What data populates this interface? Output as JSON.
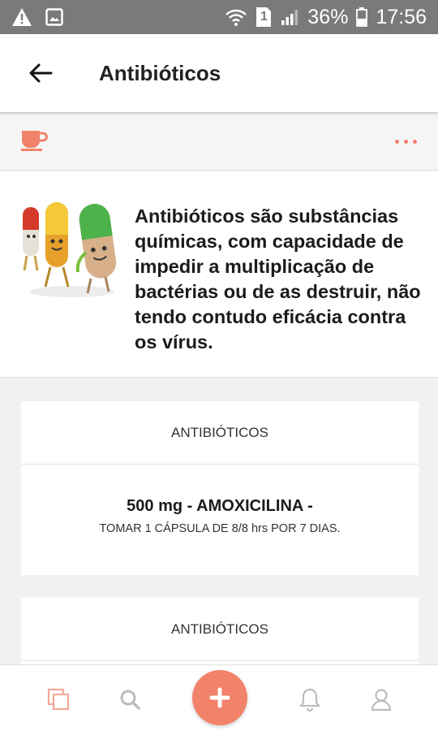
{
  "status_bar": {
    "battery": "36%",
    "time": "17:56",
    "sim": "1",
    "icons": [
      "warning-icon",
      "image-icon",
      "wifi-icon",
      "sim-icon",
      "signal-icon",
      "battery-icon"
    ]
  },
  "app_bar": {
    "title": "Antibióticos",
    "back_icon": "arrow-left-icon"
  },
  "toolbar": {
    "left_icon": "cup-icon",
    "right_icon": "more-dots-icon"
  },
  "description": {
    "text": "Antibióticos são substâncias químicas, com capacidade de impedir a multiplicação de bactérias ou de as destruir, não tendo contudo eficácia contra os vírus.",
    "image": "pills-cartoon-illustration"
  },
  "cards": [
    {
      "header": "ANTIBIÓTICOS",
      "medication": "500 mg - AMOXICILINA -",
      "instructions": "TOMAR 1 CÁPSULA DE 8/8 hrs POR 7 DIAS."
    },
    {
      "header": "ANTIBIÓTICOS"
    }
  ],
  "bottom_nav": {
    "items": [
      "copy-icon",
      "search-icon",
      "add-icon",
      "bell-icon",
      "user-icon"
    ]
  },
  "colors": {
    "accent": "#f2826a",
    "status_bar": "#7a7a7a",
    "background": "#f1f1f1",
    "nav_icon": "#bcbcbc"
  }
}
